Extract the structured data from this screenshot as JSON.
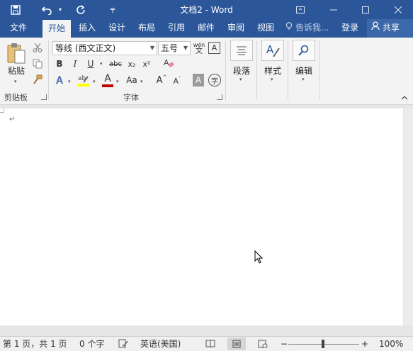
{
  "window": {
    "title": "文档2 - Word"
  },
  "qat": {
    "save_icon": "save-icon",
    "undo_icon": "undo-icon",
    "redo_icon": "redo-icon",
    "customize_icon": "customize-qat-icon"
  },
  "tabs": [
    {
      "label": "文件",
      "active": false
    },
    {
      "label": "开始",
      "active": true
    },
    {
      "label": "插入",
      "active": false
    },
    {
      "label": "设计",
      "active": false
    },
    {
      "label": "布局",
      "active": false
    },
    {
      "label": "引用",
      "active": false
    },
    {
      "label": "邮件",
      "active": false
    },
    {
      "label": "审阅",
      "active": false
    },
    {
      "label": "视图",
      "active": false
    }
  ],
  "tell_me": {
    "placeholder": "告诉我..."
  },
  "account": {
    "login_label": "登录",
    "share_label": "共享"
  },
  "ribbon": {
    "clipboard": {
      "paste_label": "粘贴",
      "group_label": "剪贴板"
    },
    "font": {
      "font_name": "等线 (西文正文)",
      "font_size": "五号",
      "phonetic_top": "wén",
      "phonetic_bottom": "文",
      "char_border": "A",
      "bold": "B",
      "italic": "I",
      "underline": "U",
      "strike": "abc",
      "subscript": "x₂",
      "superscript": "x²",
      "grow": "A",
      "shrink": "A",
      "change_case": "Aa",
      "char_shading": "A",
      "enclose": "字",
      "font_color": "A",
      "group_label": "字体"
    },
    "paragraph": {
      "label": "段落"
    },
    "styles": {
      "label": "样式"
    },
    "editing": {
      "label": "编辑"
    }
  },
  "document": {
    "paragraph_mark": "↵"
  },
  "status": {
    "page": "第 1 页，共 1 页",
    "words": "0 个字",
    "language": "英语(美国)",
    "zoom": "100%",
    "zoom_minus": "−",
    "zoom_plus": "+"
  },
  "colors": {
    "brand": "#2b579a",
    "font_color": "#c00000",
    "highlight": "#ffff00"
  }
}
